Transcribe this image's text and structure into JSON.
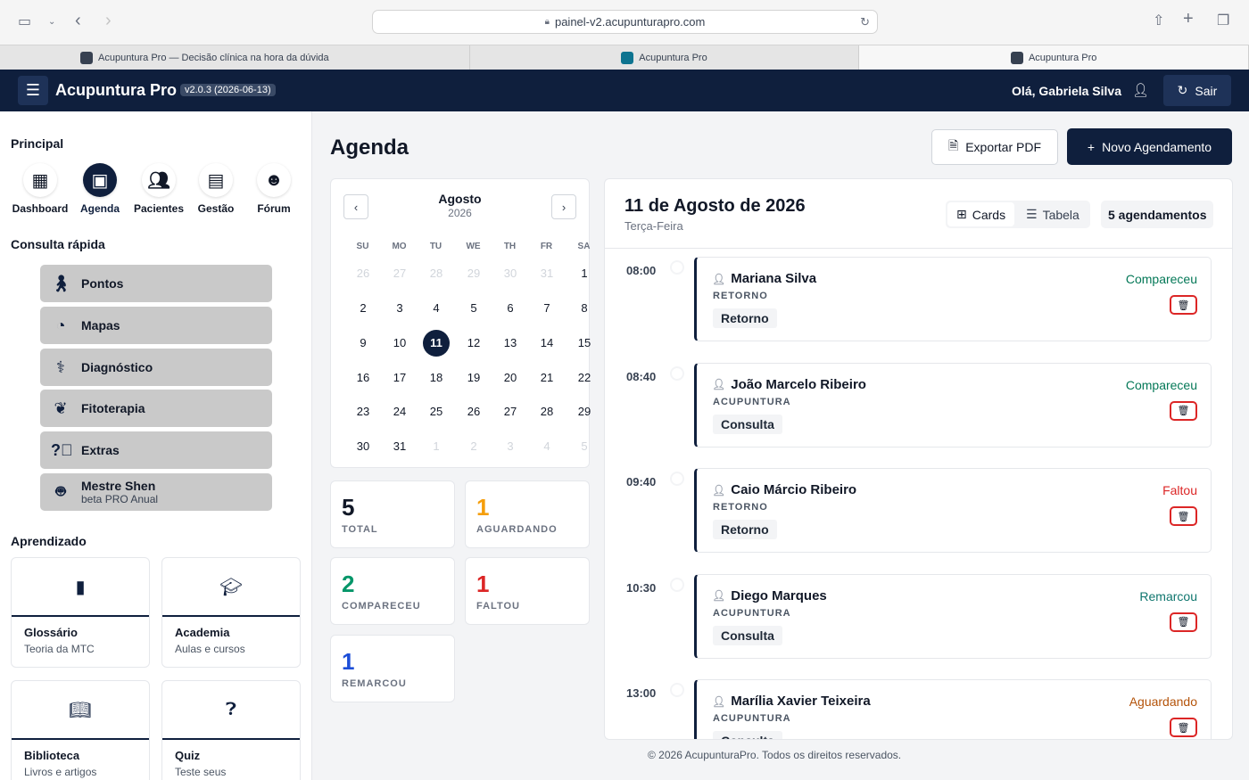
{
  "browser": {
    "url": "painel-v2.acupunturapro.com"
  },
  "tabs": [
    {
      "label": "Acupuntura Pro — Decisão clínica na hora da dúvida"
    },
    {
      "label": "Acupuntura Pro"
    },
    {
      "label": "Acupuntura Pro"
    }
  ],
  "header": {
    "brand": "Acupuntura Pro",
    "version": "v2.0.3 (2026-06-13)",
    "greeting": "Olá, Gabriela Silva",
    "logout": "Sair"
  },
  "sidebar": {
    "principal_title": "Principal",
    "nav": [
      {
        "label": "Dashboard",
        "icon": "dashboard-icon"
      },
      {
        "label": "Agenda",
        "icon": "calendar-icon"
      },
      {
        "label": "Pacientes",
        "icon": "users-icon"
      },
      {
        "label": "Gestão",
        "icon": "cash-register-icon"
      },
      {
        "label": "Fórum",
        "icon": "forum-icon"
      }
    ],
    "quick_title": "Consulta rápida",
    "quick": [
      {
        "label": "Pontos",
        "icon": "person-icon"
      },
      {
        "label": "Mapas",
        "icon": "ear-icon"
      },
      {
        "label": "Diagnóstico",
        "icon": "stethoscope-icon"
      },
      {
        "label": "Fitoterapia",
        "icon": "leaf-icon"
      },
      {
        "label": "Extras",
        "icon": "question-icon"
      },
      {
        "label": "Mestre Shen",
        "sub": "beta PRO Anual",
        "icon": "robot-icon"
      }
    ],
    "learn_title": "Aprendizado",
    "learn": [
      {
        "title": "Glossário",
        "sub": "Teoria da MTC",
        "icon": "book-icon"
      },
      {
        "title": "Academia",
        "sub": "Aulas e cursos",
        "icon": "graduation-cap-icon"
      },
      {
        "title": "Biblioteca",
        "sub": "Livros e artigos",
        "icon": "open-book-icon"
      },
      {
        "title": "Quiz",
        "sub": "Teste seus",
        "icon": "quiz-icon"
      }
    ]
  },
  "main": {
    "title": "Agenda",
    "export_label": "Exportar PDF",
    "new_label": "Novo Agendamento"
  },
  "calendar": {
    "month": "Agosto",
    "year": "2026",
    "dow": [
      "SU",
      "MO",
      "TU",
      "WE",
      "TH",
      "FR",
      "SA"
    ],
    "weeks": [
      [
        "26",
        "27",
        "28",
        "29",
        "30",
        "31",
        "1"
      ],
      [
        "2",
        "3",
        "4",
        "5",
        "6",
        "7",
        "8"
      ],
      [
        "9",
        "10",
        "11",
        "12",
        "13",
        "14",
        "15"
      ],
      [
        "16",
        "17",
        "18",
        "19",
        "20",
        "21",
        "22"
      ],
      [
        "23",
        "24",
        "25",
        "26",
        "27",
        "28",
        "29"
      ],
      [
        "30",
        "31",
        "1",
        "2",
        "3",
        "4",
        "5"
      ]
    ],
    "selected": "11"
  },
  "stats": [
    {
      "value": "5",
      "label": "TOTAL",
      "color": "#111827"
    },
    {
      "value": "1",
      "label": "AGUARDANDO",
      "color": "#f59e0b"
    },
    {
      "value": "2",
      "label": "COMPARECEU",
      "color": "#059669"
    },
    {
      "value": "1",
      "label": "FALTOU",
      "color": "#dc2626"
    },
    {
      "value": "1",
      "label": "REMARCOU",
      "color": "#1d4ed8"
    }
  ],
  "panel": {
    "date": "11 de Agosto de 2026",
    "weekday": "Terça-Feira",
    "view_cards": "Cards",
    "view_table": "Tabela",
    "count": "5 agendamentos"
  },
  "appointments": [
    {
      "time": "08:00",
      "name": "Mariana Silva",
      "type": "RETORNO",
      "tag": "Retorno",
      "status": "Compareceu",
      "status_color": "#047857"
    },
    {
      "time": "08:40",
      "name": "João Marcelo Ribeiro",
      "type": "ACUPUNTURA",
      "tag": "Consulta",
      "status": "Compareceu",
      "status_color": "#047857"
    },
    {
      "time": "09:40",
      "name": "Caio Márcio Ribeiro",
      "type": "RETORNO",
      "tag": "Retorno",
      "status": "Faltou",
      "status_color": "#dc2626"
    },
    {
      "time": "10:30",
      "name": "Diego Marques",
      "type": "ACUPUNTURA",
      "tag": "Consulta",
      "status": "Remarcou",
      "status_color": "#0f766e"
    },
    {
      "time": "13:00",
      "name": "Marília Xavier Teixeira",
      "type": "ACUPUNTURA",
      "tag": "Consulta",
      "status": "Aguardando",
      "status_color": "#b45309"
    }
  ],
  "footer": "© 2026 AcupunturaPro. Todos os direitos reservados."
}
